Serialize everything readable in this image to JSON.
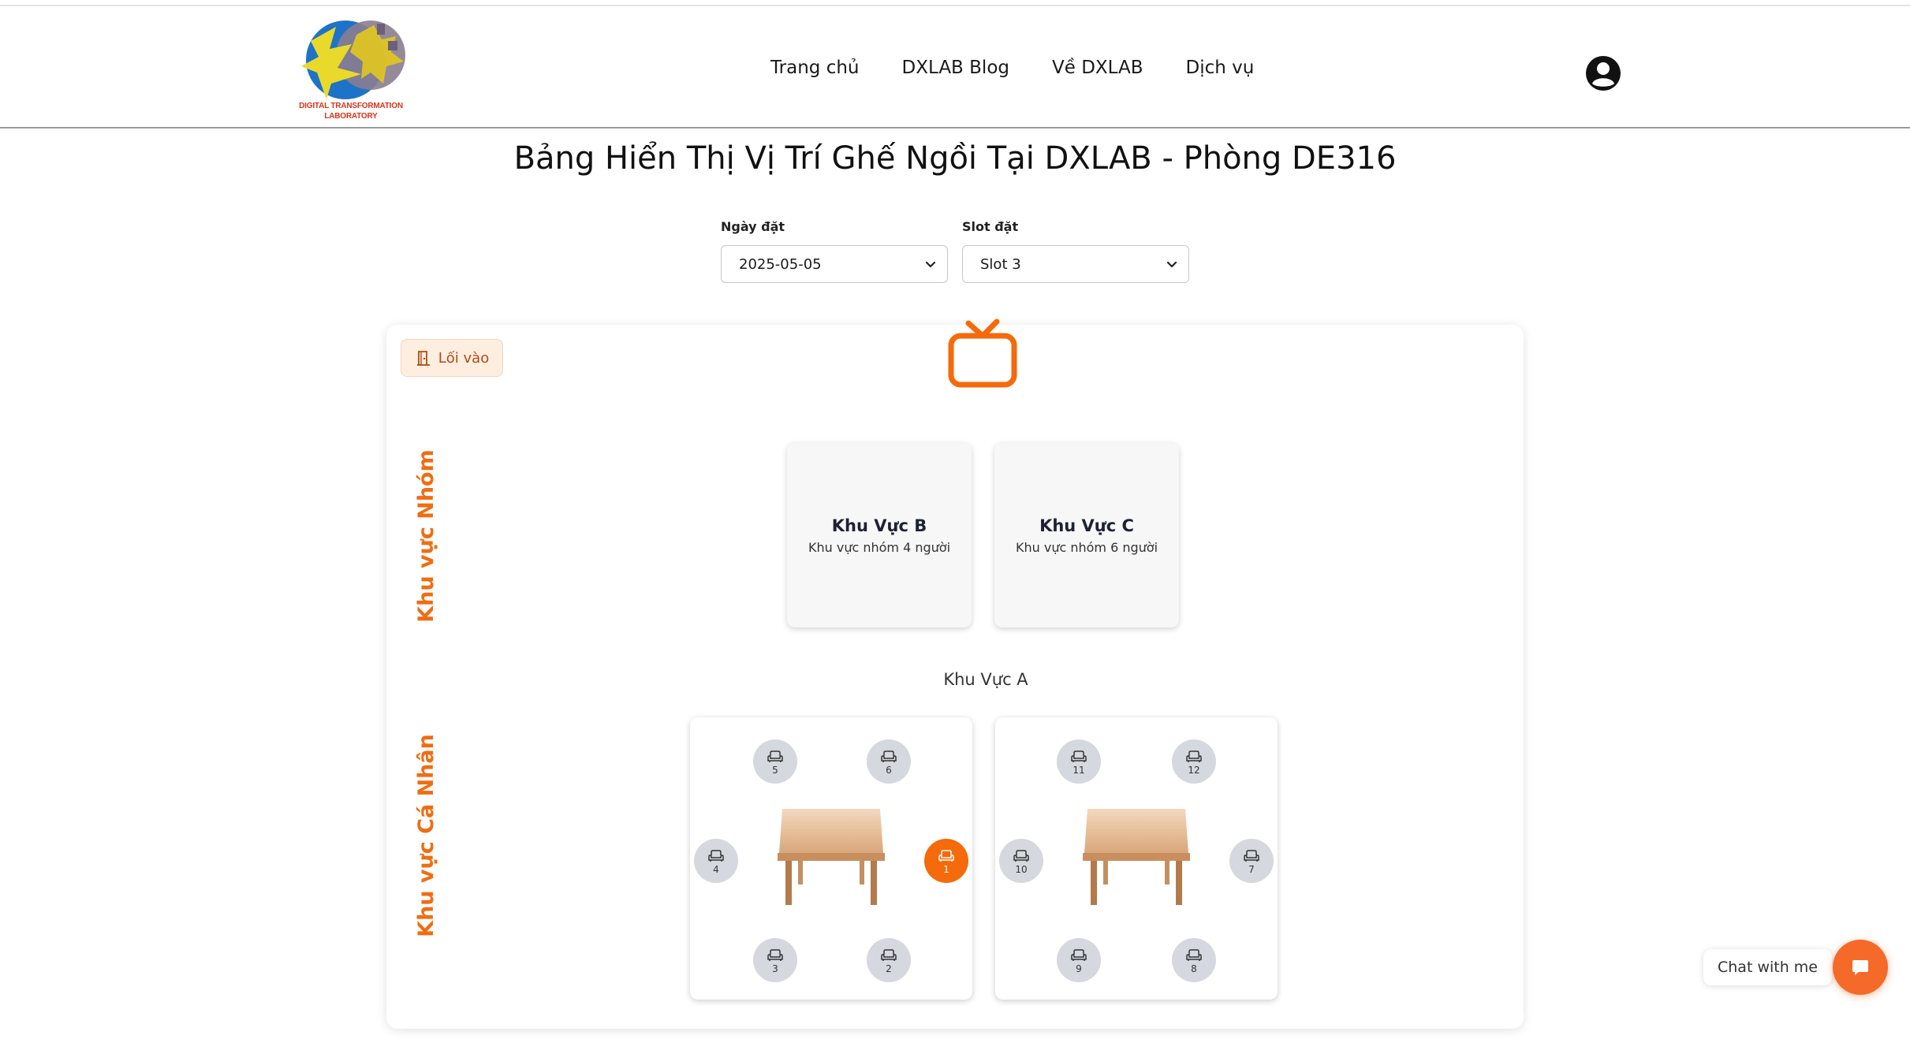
{
  "header": {
    "logo_text_line1": "DIGITAL TRANSFORMATION",
    "logo_text_line2": "LABORATORY",
    "nav": [
      "Trang chủ",
      "DXLAB Blog",
      "Về DXLAB",
      "Dịch vụ"
    ]
  },
  "page_title": "Bảng Hiển Thị Vị Trí Ghế Ngồi Tại DXLAB - Phòng DE316",
  "filters": {
    "date": {
      "label": "Ngày đặt",
      "value": "2025-05-05"
    },
    "slot": {
      "label": "Slot đặt",
      "value": "Slot 3"
    }
  },
  "entry_button": "Lối vào",
  "zones": {
    "group_label": "Khu vực Nhóm",
    "personal_label": "Khu vực Cá Nhân"
  },
  "group_areas": [
    {
      "name": "Khu Vực B",
      "desc": "Khu vực nhóm 4 người"
    },
    {
      "name": "Khu Vực C",
      "desc": "Khu vực nhóm 6 người"
    }
  ],
  "zone_a_title": "Khu Vực A",
  "tables": [
    {
      "seats": {
        "top_left": "5",
        "top_right": "6",
        "left": "4",
        "right": "1",
        "bottom_left": "3",
        "bottom_right": "2"
      },
      "selected": "1"
    },
    {
      "seats": {
        "top_left": "11",
        "top_right": "12",
        "left": "10",
        "right": "7",
        "bottom_left": "9",
        "bottom_right": "8"
      },
      "selected": ""
    }
  ],
  "chat": {
    "label": "Chat with me"
  },
  "colors": {
    "accent": "#f56a0a",
    "seat_free": "#d5d8de",
    "zone_label": "#f06d12"
  },
  "icons": [
    "user-icon",
    "tv-icon",
    "door-icon",
    "chevron-down-icon",
    "armchair-icon",
    "chat-icon"
  ]
}
